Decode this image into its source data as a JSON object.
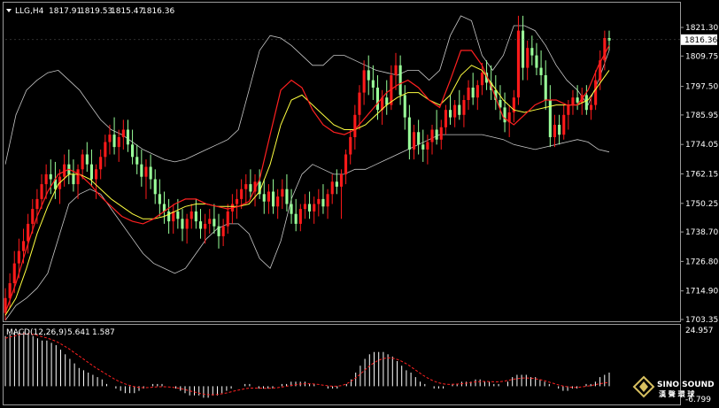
{
  "header": {
    "symbol": "LLG,H4",
    "open": "1817.91",
    "high": "1819.53",
    "low": "1815.47",
    "close": "1816.36"
  },
  "macd": {
    "label": "MACD(12,26,9)",
    "main": "5.641",
    "signal": "1.587",
    "axis_max": "24.957",
    "axis_min": "-6.799"
  },
  "logo": {
    "name": "SINO SOUND",
    "sub": "漢 聲 環 球"
  },
  "colors": {
    "background": "#000000",
    "bull_candle": "#ff1a1a",
    "bear_candle": "#99ff99",
    "bollinger": "#c8c8c8",
    "ma_fast": "#ff2020",
    "ma_slow": "#ffff40",
    "macd_hist": "#ffffff",
    "macd_signal": "#ff2020",
    "current_price_box": "#ffffff"
  },
  "chart_data": {
    "type": "candlestick",
    "price_axis": {
      "ticks": [
        "1821.30",
        "1809.75",
        "1797.50",
        "1785.95",
        "1774.05",
        "1762.15",
        "1750.25",
        "1738.70",
        "1726.80",
        "1714.90",
        "1703.35"
      ],
      "min": 1703.35,
      "max": 1821.3,
      "current": "1816.36"
    },
    "macd_axis": {
      "min": -6.799,
      "max": 24.957
    },
    "candles_ohlc": [
      [
        1706,
        1716,
        1703,
        1712
      ],
      [
        1712,
        1722,
        1708,
        1718
      ],
      [
        1718,
        1731,
        1714,
        1726
      ],
      [
        1726,
        1736,
        1720,
        1731
      ],
      [
        1731,
        1740,
        1726,
        1735
      ],
      [
        1735,
        1746,
        1730,
        1742
      ],
      [
        1742,
        1752,
        1738,
        1748
      ],
      [
        1748,
        1756,
        1742,
        1752
      ],
      [
        1752,
        1762,
        1748,
        1758
      ],
      [
        1758,
        1766,
        1752,
        1762
      ],
      [
        1762,
        1768,
        1754,
        1760
      ],
      [
        1760,
        1767,
        1752,
        1756
      ],
      [
        1756,
        1764,
        1750,
        1761
      ],
      [
        1761,
        1770,
        1757,
        1766
      ],
      [
        1766,
        1772,
        1758,
        1762
      ],
      [
        1762,
        1768,
        1755,
        1758
      ],
      [
        1758,
        1766,
        1752,
        1764
      ],
      [
        1764,
        1772,
        1760,
        1770
      ],
      [
        1770,
        1775,
        1763,
        1766
      ],
      [
        1766,
        1772,
        1757,
        1760
      ],
      [
        1760,
        1766,
        1752,
        1764
      ],
      [
        1764,
        1772,
        1760,
        1769
      ],
      [
        1769,
        1778,
        1765,
        1775
      ],
      [
        1775,
        1782,
        1770,
        1778
      ],
      [
        1778,
        1785,
        1770,
        1773
      ],
      [
        1773,
        1780,
        1767,
        1777
      ],
      [
        1777,
        1784,
        1772,
        1780
      ],
      [
        1780,
        1784,
        1771,
        1774
      ],
      [
        1774,
        1780,
        1766,
        1769
      ],
      [
        1769,
        1774,
        1762,
        1766
      ],
      [
        1766,
        1772,
        1757,
        1761
      ],
      [
        1761,
        1768,
        1752,
        1765
      ],
      [
        1765,
        1770,
        1756,
        1760
      ],
      [
        1760,
        1764,
        1750,
        1754
      ],
      [
        1754,
        1760,
        1745,
        1750
      ],
      [
        1750,
        1755,
        1742,
        1747
      ],
      [
        1747,
        1752,
        1738,
        1743
      ],
      [
        1743,
        1750,
        1738,
        1747
      ],
      [
        1747,
        1752,
        1740,
        1744
      ],
      [
        1744,
        1748,
        1735,
        1740
      ],
      [
        1740,
        1746,
        1734,
        1744
      ],
      [
        1744,
        1750,
        1740,
        1747
      ],
      [
        1747,
        1752,
        1740,
        1743
      ],
      [
        1743,
        1748,
        1736,
        1740
      ],
      [
        1740,
        1746,
        1734,
        1742
      ],
      [
        1742,
        1748,
        1738,
        1744
      ],
      [
        1744,
        1750,
        1738,
        1741
      ],
      [
        1741,
        1746,
        1732,
        1737
      ],
      [
        1737,
        1744,
        1733,
        1741
      ],
      [
        1741,
        1750,
        1738,
        1747
      ],
      [
        1747,
        1754,
        1742,
        1750
      ],
      [
        1750,
        1756,
        1744,
        1752
      ],
      [
        1752,
        1760,
        1748,
        1756
      ],
      [
        1756,
        1762,
        1750,
        1758
      ],
      [
        1758,
        1764,
        1752,
        1755
      ],
      [
        1755,
        1762,
        1749,
        1759
      ],
      [
        1759,
        1764,
        1752,
        1754
      ],
      [
        1754,
        1760,
        1746,
        1751
      ],
      [
        1751,
        1758,
        1746,
        1755
      ],
      [
        1755,
        1760,
        1746,
        1749
      ],
      [
        1749,
        1756,
        1744,
        1753
      ],
      [
        1753,
        1760,
        1748,
        1756
      ],
      [
        1756,
        1762,
        1747,
        1750
      ],
      [
        1750,
        1756,
        1742,
        1746
      ],
      [
        1746,
        1752,
        1739,
        1742
      ],
      [
        1742,
        1750,
        1739,
        1748
      ],
      [
        1748,
        1754,
        1744,
        1750
      ],
      [
        1750,
        1755,
        1744,
        1747
      ],
      [
        1747,
        1753,
        1742,
        1750
      ],
      [
        1750,
        1756,
        1745,
        1752
      ],
      [
        1752,
        1758,
        1746,
        1749
      ],
      [
        1749,
        1756,
        1744,
        1754
      ],
      [
        1754,
        1762,
        1750,
        1759
      ],
      [
        1759,
        1764,
        1754,
        1757
      ],
      [
        1757,
        1764,
        1744,
        1762
      ],
      [
        1762,
        1772,
        1758,
        1770
      ],
      [
        1770,
        1780,
        1766,
        1777
      ],
      [
        1777,
        1790,
        1772,
        1786
      ],
      [
        1786,
        1798,
        1780,
        1795
      ],
      [
        1795,
        1808,
        1790,
        1804
      ],
      [
        1804,
        1810,
        1794,
        1800
      ],
      [
        1800,
        1806,
        1792,
        1797
      ],
      [
        1797,
        1802,
        1784,
        1788
      ],
      [
        1788,
        1796,
        1782,
        1793
      ],
      [
        1793,
        1800,
        1786,
        1790
      ],
      [
        1790,
        1806,
        1788,
        1802
      ],
      [
        1802,
        1811,
        1796,
        1806
      ],
      [
        1806,
        1810,
        1790,
        1794
      ],
      [
        1794,
        1798,
        1780,
        1785
      ],
      [
        1785,
        1790,
        1768,
        1772
      ],
      [
        1772,
        1782,
        1768,
        1779
      ],
      [
        1779,
        1784,
        1770,
        1774
      ],
      [
        1774,
        1780,
        1767,
        1772
      ],
      [
        1772,
        1778,
        1766,
        1775
      ],
      [
        1775,
        1782,
        1770,
        1780
      ],
      [
        1780,
        1788,
        1774,
        1776
      ],
      [
        1776,
        1784,
        1772,
        1781
      ],
      [
        1781,
        1790,
        1778,
        1788
      ],
      [
        1788,
        1794,
        1782,
        1785
      ],
      [
        1785,
        1792,
        1781,
        1790
      ],
      [
        1790,
        1796,
        1784,
        1786
      ],
      [
        1786,
        1794,
        1781,
        1792
      ],
      [
        1792,
        1800,
        1788,
        1797
      ],
      [
        1797,
        1803,
        1790,
        1793
      ],
      [
        1793,
        1800,
        1788,
        1798
      ],
      [
        1798,
        1807,
        1794,
        1803
      ],
      [
        1803,
        1808,
        1796,
        1799
      ],
      [
        1799,
        1806,
        1792,
        1796
      ],
      [
        1796,
        1802,
        1788,
        1792
      ],
      [
        1792,
        1798,
        1784,
        1789
      ],
      [
        1789,
        1795,
        1779,
        1783
      ],
      [
        1783,
        1790,
        1777,
        1787
      ],
      [
        1787,
        1796,
        1783,
        1793
      ],
      [
        1793,
        1826,
        1790,
        1820
      ],
      [
        1820,
        1826,
        1800,
        1805
      ],
      [
        1805,
        1816,
        1800,
        1813
      ],
      [
        1813,
        1818,
        1806,
        1810
      ],
      [
        1810,
        1815,
        1802,
        1805
      ],
      [
        1805,
        1812,
        1798,
        1802
      ],
      [
        1802,
        1808,
        1788,
        1792
      ],
      [
        1792,
        1798,
        1773,
        1777
      ],
      [
        1777,
        1786,
        1773,
        1782
      ],
      [
        1782,
        1786,
        1774,
        1778
      ],
      [
        1778,
        1790,
        1776,
        1786
      ],
      [
        1786,
        1792,
        1780,
        1790
      ],
      [
        1790,
        1796,
        1786,
        1793
      ],
      [
        1793,
        1798,
        1788,
        1791
      ],
      [
        1791,
        1797,
        1786,
        1794
      ],
      [
        1794,
        1798,
        1786,
        1788
      ],
      [
        1788,
        1794,
        1784,
        1790
      ],
      [
        1790,
        1804,
        1788,
        1800
      ],
      [
        1800,
        1812,
        1796,
        1808
      ],
      [
        1808,
        1820,
        1804,
        1817
      ],
      [
        1817,
        1820,
        1812,
        1816
      ]
    ],
    "bollinger_upper": [
      1766,
      1786,
      1796,
      1800,
      1803,
      1804,
      1800,
      1796,
      1790,
      1784,
      1780,
      1778,
      1775,
      1772,
      1770,
      1768,
      1767,
      1768,
      1770,
      1772,
      1774,
      1776,
      1780,
      1796,
      1812,
      1818,
      1817,
      1814,
      1810,
      1806,
      1806,
      1810,
      1810,
      1808,
      1806,
      1804,
      1803,
      1802,
      1804,
      1804,
      1800,
      1804,
      1818,
      1826,
      1824,
      1810,
      1804,
      1810,
      1822,
      1822,
      1820,
      1814,
      1806,
      1800,
      1796,
      1790,
      1800,
      1812
    ],
    "bollinger_lower": [
      1703,
      1709,
      1712,
      1716,
      1722,
      1736,
      1750,
      1754,
      1756,
      1754,
      1748,
      1742,
      1736,
      1730,
      1726,
      1724,
      1722,
      1724,
      1730,
      1736,
      1740,
      1742,
      1742,
      1738,
      1728,
      1724,
      1735,
      1752,
      1762,
      1766,
      1764,
      1762,
      1762,
      1764,
      1764,
      1766,
      1768,
      1770,
      1772,
      1774,
      1776,
      1778,
      1778,
      1778,
      1778,
      1778,
      1777,
      1776,
      1774,
      1773,
      1772,
      1773,
      1774,
      1775,
      1776,
      1775,
      1772,
      1771
    ],
    "ma_fast": [
      1706,
      1718,
      1732,
      1745,
      1755,
      1762,
      1764,
      1762,
      1758,
      1753,
      1749,
      1745,
      1743,
      1742,
      1744,
      1747,
      1750,
      1752,
      1752,
      1750,
      1749,
      1748,
      1749,
      1751,
      1760,
      1778,
      1796,
      1800,
      1797,
      1788,
      1782,
      1779,
      1778,
      1780,
      1785,
      1790,
      1795,
      1798,
      1800,
      1797,
      1792,
      1789,
      1800,
      1812,
      1812,
      1806,
      1796,
      1785,
      1782,
      1786,
      1790,
      1792,
      1792,
      1790,
      1790,
      1796,
      1806,
      1814
    ],
    "ma_slow": [
      1705,
      1712,
      1724,
      1738,
      1749,
      1758,
      1762,
      1762,
      1760,
      1756,
      1752,
      1749,
      1746,
      1744,
      1744,
      1745,
      1747,
      1749,
      1750,
      1750,
      1749,
      1749,
      1749,
      1750,
      1755,
      1766,
      1782,
      1792,
      1794,
      1790,
      1786,
      1782,
      1780,
      1780,
      1782,
      1786,
      1790,
      1793,
      1795,
      1795,
      1792,
      1790,
      1794,
      1802,
      1806,
      1804,
      1798,
      1792,
      1788,
      1787,
      1788,
      1789,
      1790,
      1790,
      1790,
      1792,
      1798,
      1804
    ],
    "macd_histogram": [
      22,
      23,
      24,
      24,
      24,
      23,
      22,
      21,
      20,
      20,
      19,
      18,
      16,
      14,
      12,
      10,
      8,
      7,
      6,
      5,
      4,
      3,
      1,
      0,
      -1,
      -2,
      -3,
      -3,
      -3,
      -2,
      -1,
      0,
      1,
      1,
      1,
      0,
      0,
      -1,
      -2,
      -3,
      -4,
      -4,
      -4,
      -5,
      -5,
      -4,
      -4,
      -3,
      -2,
      -1,
      0,
      0,
      1,
      1,
      0,
      -1,
      -1,
      -1,
      -1,
      0,
      1,
      1,
      2,
      2,
      2,
      2,
      1,
      1,
      0,
      0,
      -1,
      -1,
      -1,
      0,
      1,
      3,
      6,
      9,
      12,
      14,
      15,
      15,
      15,
      14,
      13,
      11,
      9,
      7,
      6,
      4,
      2,
      1,
      0,
      -1,
      -1,
      -1,
      0,
      1,
      1,
      2,
      2,
      2,
      3,
      3,
      2,
      2,
      1,
      1,
      0,
      2,
      4,
      5,
      5,
      5,
      4,
      4,
      3,
      2,
      1,
      0,
      -1,
      -2,
      -2,
      -1,
      -1,
      0,
      1,
      1,
      2,
      4,
      5,
      6
    ],
    "macd_signal": [
      21,
      21.5,
      22,
      22.5,
      23,
      23,
      22.8,
      22.3,
      21.8,
      21.2,
      20.6,
      19.8,
      18.8,
      17.6,
      16.4,
      15,
      13.6,
      12.2,
      10.8,
      9.4,
      8,
      6.8,
      5.6,
      4.4,
      3.2,
      2.2,
      1.3,
      0.6,
      0,
      -0.4,
      -0.6,
      -0.6,
      -0.5,
      -0.3,
      -0.2,
      -0.2,
      -0.3,
      -0.5,
      -0.8,
      -1.2,
      -1.7,
      -2.2,
      -2.7,
      -3.2,
      -3.5,
      -3.7,
      -3.7,
      -3.5,
      -3.2,
      -2.8,
      -2.3,
      -1.8,
      -1.4,
      -1,
      -0.8,
      -0.8,
      -0.8,
      -0.9,
      -0.9,
      -0.8,
      -0.6,
      -0.3,
      0,
      0.4,
      0.7,
      1,
      1.1,
      1.1,
      1,
      0.8,
      0.5,
      0.2,
      0,
      0,
      0.3,
      0.9,
      2,
      3.4,
      5,
      6.8,
      8.5,
      10,
      11.2,
      12,
      12.4,
      12.4,
      12,
      11.2,
      10.2,
      9,
      7.6,
      6.2,
      4.8,
      3.6,
      2.6,
      1.8,
      1.2,
      0.9,
      0.8,
      0.9,
      1,
      1.2,
      1.5,
      1.8,
      2,
      2.1,
      2.1,
      2,
      1.9,
      2,
      2.3,
      2.7,
      3.1,
      3.4,
      3.6,
      3.6,
      3.5,
      3.2,
      2.8,
      2.3,
      1.7,
      1.1,
      0.5,
      0,
      -0.3,
      -0.5,
      -0.5,
      -0.3,
      0,
      0.3,
      0.7,
      1.1,
      1.5,
      1.6
    ]
  }
}
